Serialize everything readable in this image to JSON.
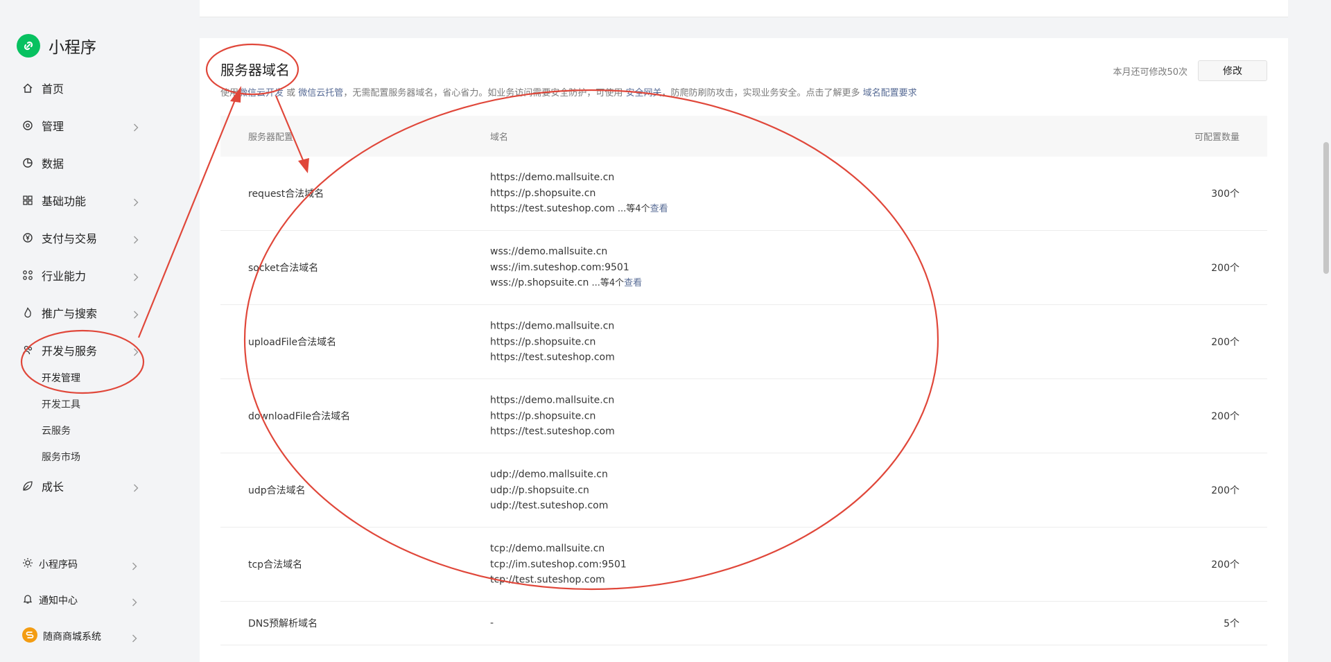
{
  "brand": {
    "name": "小程序",
    "logo_icon": "link-icon",
    "color": "#07c160"
  },
  "sidebar": {
    "items": [
      {
        "label": "首页",
        "icon": "home-icon",
        "chevron": false
      },
      {
        "label": "管理",
        "icon": "target-icon",
        "chevron": true
      },
      {
        "label": "数据",
        "icon": "pie-chart-icon",
        "chevron": false
      },
      {
        "label": "基础功能",
        "icon": "grid-icon",
        "chevron": true
      },
      {
        "label": "支付与交易",
        "icon": "yen-icon",
        "chevron": true
      },
      {
        "label": "行业能力",
        "icon": "nodes-icon",
        "chevron": true
      },
      {
        "label": "推广与搜索",
        "icon": "flame-icon",
        "chevron": true
      },
      {
        "label": "开发与服务",
        "icon": "people-icon",
        "chevron": true
      },
      {
        "label": "成长",
        "icon": "leaf-icon",
        "chevron": true
      }
    ],
    "sub_items": [
      "开发管理",
      "开发工具",
      "云服务",
      "服务市场"
    ],
    "bottom": [
      {
        "label": "小程序码",
        "icon": "sun-icon"
      },
      {
        "label": "通知中心",
        "icon": "bell-icon"
      },
      {
        "label": "随商商城系统",
        "icon": "shop-logo-icon"
      }
    ]
  },
  "section": {
    "title": "服务器域名",
    "desc_prefix": "使用",
    "link_cloud_dev": "微信云开发",
    "desc_or": " 或 ",
    "link_cloud_host": "微信云托管",
    "desc_mid": "，无需配置服务器域名，省心省力。如业务访问需要安全防护，可使用 ",
    "link_gateway": "安全网关",
    "desc_mid2": "，防爬防刷防攻击，实现业务安全。点击了解更多 ",
    "link_requirements": "域名配置要求",
    "quota_text": "本月还可修改50次",
    "modify_label": "修改"
  },
  "table": {
    "headers": {
      "config": "服务器配置",
      "domain": "域名",
      "count": "可配置数量"
    },
    "rows": [
      {
        "name": "request合法域名",
        "domains": [
          "https://demo.mallsuite.cn",
          "https://p.shopsuite.cn",
          "https://test.suteshop.com"
        ],
        "more": " ...等4个",
        "view": "查看",
        "count": "300个"
      },
      {
        "name": "socket合法域名",
        "domains": [
          "wss://demo.mallsuite.cn",
          "wss://im.suteshop.com:9501",
          "wss://p.shopsuite.cn"
        ],
        "more": " ...等4个",
        "view": "查看",
        "count": "200个"
      },
      {
        "name": "uploadFile合法域名",
        "domains": [
          "https://demo.mallsuite.cn",
          "https://p.shopsuite.cn",
          "https://test.suteshop.com"
        ],
        "more": "",
        "view": "",
        "count": "200个"
      },
      {
        "name": "downloadFile合法域名",
        "domains": [
          "https://demo.mallsuite.cn",
          "https://p.shopsuite.cn",
          "https://test.suteshop.com"
        ],
        "more": "",
        "view": "",
        "count": "200个"
      },
      {
        "name": "udp合法域名",
        "domains": [
          "udp://demo.mallsuite.cn",
          "udp://p.shopsuite.cn",
          "udp://test.suteshop.com"
        ],
        "more": "",
        "view": "",
        "count": "200个"
      },
      {
        "name": "tcp合法域名",
        "domains": [
          "tcp://demo.mallsuite.cn",
          "tcp://im.suteshop.com:9501",
          "tcp://test.suteshop.com"
        ],
        "more": "",
        "view": "",
        "count": "200个"
      },
      {
        "name": "DNS预解析域名",
        "domains": [
          "-"
        ],
        "more": "",
        "view": "",
        "count": "5个"
      }
    ]
  },
  "annotation_color": "#e0473a"
}
